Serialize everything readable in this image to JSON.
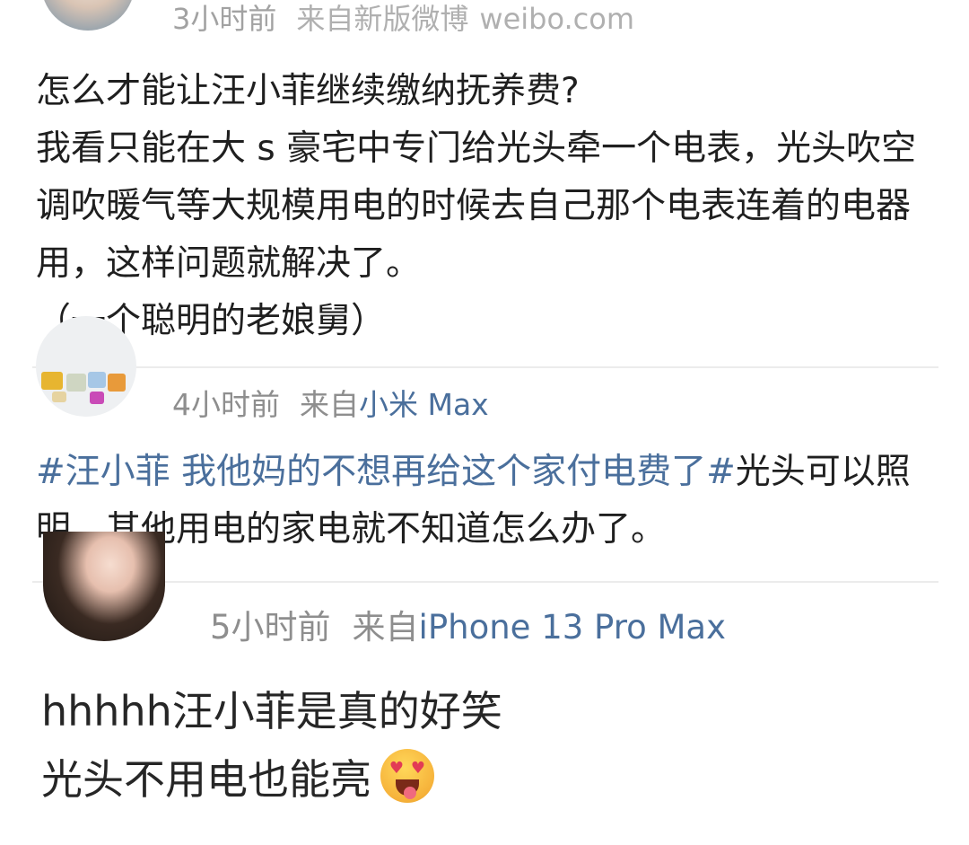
{
  "posts": [
    {
      "time": "3小时前",
      "source_prefix": "来自新版微博",
      "source_link": "weibo.com",
      "text": "怎么才能让汪小菲继续缴纳抚养费?\n我看只能在大 s 豪宅中专门给光头牵一个电表，光头吹空调吹暖气等大规模用电的时候去自己那个电表连着的电器用，这样问题就解决了。\n（一个聪明的老娘舅）"
    },
    {
      "time": "4小时前",
      "source_prefix": "来自",
      "source_link": "小米 Max",
      "hashtag": "#汪小菲 我他妈的不想再给这个家付电费了#",
      "text": "光头可以照明，其他用电的家电就不知道怎么办了。"
    },
    {
      "time": "5小时前",
      "source_prefix": "来自",
      "source_link": "iPhone 13 Pro Max",
      "line1": "hhhhh汪小菲是真的好笑",
      "line2": "光头不用电也能亮",
      "emoji": "heart-eyes-tongue-emoji"
    }
  ],
  "colors": {
    "link": "#4a6f9c",
    "meta": "#8e8e8e",
    "text": "#1f1f1f",
    "divider": "#ececec"
  }
}
